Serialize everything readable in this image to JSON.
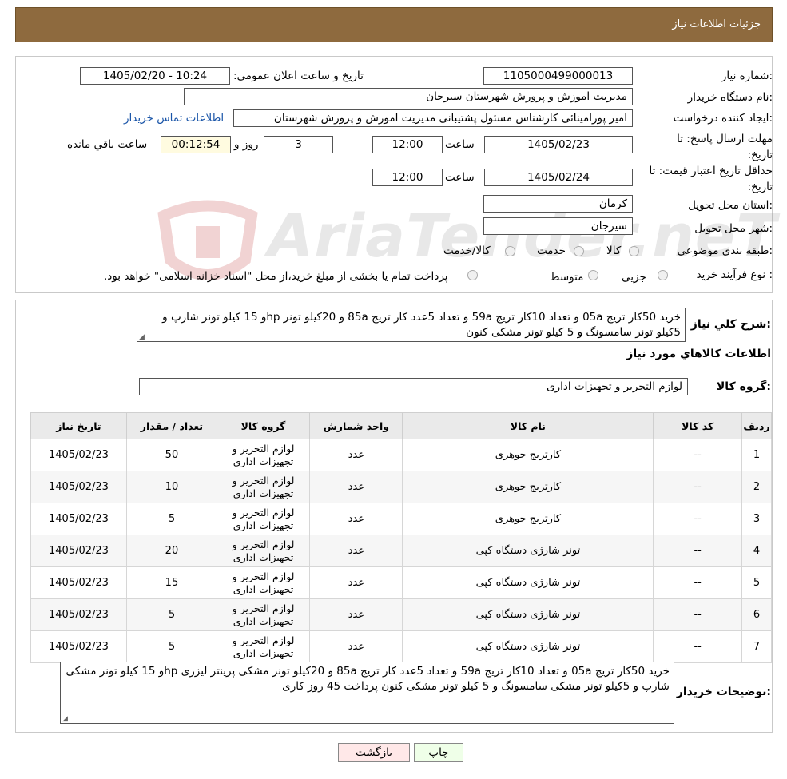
{
  "header": {
    "title": "جزئیات اطلاعات نیاز"
  },
  "form": {
    "need_number_label": "شماره نیاز:",
    "need_number": "1105000499000013",
    "announce_label": "تاریخ و ساعت اعلان عمومی:",
    "announce_value": "1405/02/20 - 10:24",
    "buyer_org_label": "نام دستگاه خریدار:",
    "buyer_org": "مدیریت اموزش و پرورش شهرستان سیرجان",
    "creator_label": "ایجاد کننده درخواست:",
    "creator": "امیر پورامینائی کارشناس مسئول پشتیبانی مدیریت اموزش و پرورش شهرستان",
    "contact_link": "اطلاعات تماس خریدار",
    "deadline_label": "مهلت ارسال پاسخ: تا تاریخ:",
    "deadline_date": "1405/02/23",
    "time_label": "ساعت",
    "deadline_time": "12:00",
    "days": "3",
    "days_label": "روز و",
    "remaining": "00:12:54",
    "remaining_label": "ساعت باقي مانده",
    "validity_label": "حداقل تاریخ اعتبار قیمت: تا تاریخ:",
    "validity_date": "1405/02/24",
    "validity_time": "12:00",
    "province_label": "استان محل تحویل:",
    "province": "کرمان",
    "city_label": "شهر محل تحویل:",
    "city": "سیرجان",
    "category_label": "طبقه بندی موضوعی:",
    "category_options": [
      "کالا",
      "خدمت",
      "کالا/خدمت"
    ],
    "process_label": "نوع فرآیند خرید :",
    "process_options": [
      "جزیی",
      "متوسط"
    ],
    "process_note": "پرداخت تمام یا بخشی از مبلغ خرید،از محل \"اسناد خزانه اسلامی\" خواهد بود."
  },
  "watermark": {
    "text": "AriaTender.neT"
  },
  "summary": {
    "label": "شرح کلي نياز:",
    "text": "خرید 50کار تریج 05a و تعداد 10کار تریج 59a و تعداد 5عدد کار تریج 85a و 20کیلو تونر  hpو 15 کیلو تونر شارپ و 5کیلو تونر سامسونگ و 5 کیلو تونر مشکی کنون"
  },
  "goods_section": {
    "title": "اطلاعات کالاهاي مورد نياز"
  },
  "goods_group": {
    "label": "گروه کالا:",
    "value": "لوازم التحریر و تجهیزات اداری"
  },
  "table": {
    "headers": [
      "رديف",
      "کد کالا",
      "نام کالا",
      "واحد شمارش",
      "گروه کالا",
      "تعداد / مقدار",
      "تاریخ نیاز"
    ],
    "rows": [
      [
        "1",
        "--",
        "کارتریج جوهری",
        "عدد",
        "لوازم التحریر و تجهیزات اداری",
        "50",
        "1405/02/23"
      ],
      [
        "2",
        "--",
        "کارتریج جوهری",
        "عدد",
        "لوازم التحریر و تجهیزات اداری",
        "10",
        "1405/02/23"
      ],
      [
        "3",
        "--",
        "کارتریج جوهری",
        "عدد",
        "لوازم التحریر و تجهیزات اداری",
        "5",
        "1405/02/23"
      ],
      [
        "4",
        "--",
        "تونر شارژی دستگاه کپی",
        "عدد",
        "لوازم التحریر و تجهیزات اداری",
        "20",
        "1405/02/23"
      ],
      [
        "5",
        "--",
        "تونر شارژی دستگاه کپی",
        "عدد",
        "لوازم التحریر و تجهیزات اداری",
        "15",
        "1405/02/23"
      ],
      [
        "6",
        "--",
        "تونر شارژی دستگاه کپی",
        "عدد",
        "لوازم التحریر و تجهیزات اداری",
        "5",
        "1405/02/23"
      ],
      [
        "7",
        "--",
        "تونر شارژی دستگاه کپی",
        "عدد",
        "لوازم التحریر و تجهیزات اداری",
        "5",
        "1405/02/23"
      ]
    ]
  },
  "buyer_notes": {
    "label": "توضیحات خریدار:",
    "text": "خرید 50کار تریج 05a و تعداد 10کار تریج 59a و تعداد 5عدد کار تریج 85a و 20کیلو تونر مشکی پرینتر لیزری hpو 15 کیلو تونر مشکی شارپ و 5کیلو تونر مشکی سامسونگ و 5 کیلو تونر مشکی کنون پرداخت 45 روز کاری"
  },
  "buttons": {
    "print": "چاپ",
    "back": "بازگشت"
  }
}
